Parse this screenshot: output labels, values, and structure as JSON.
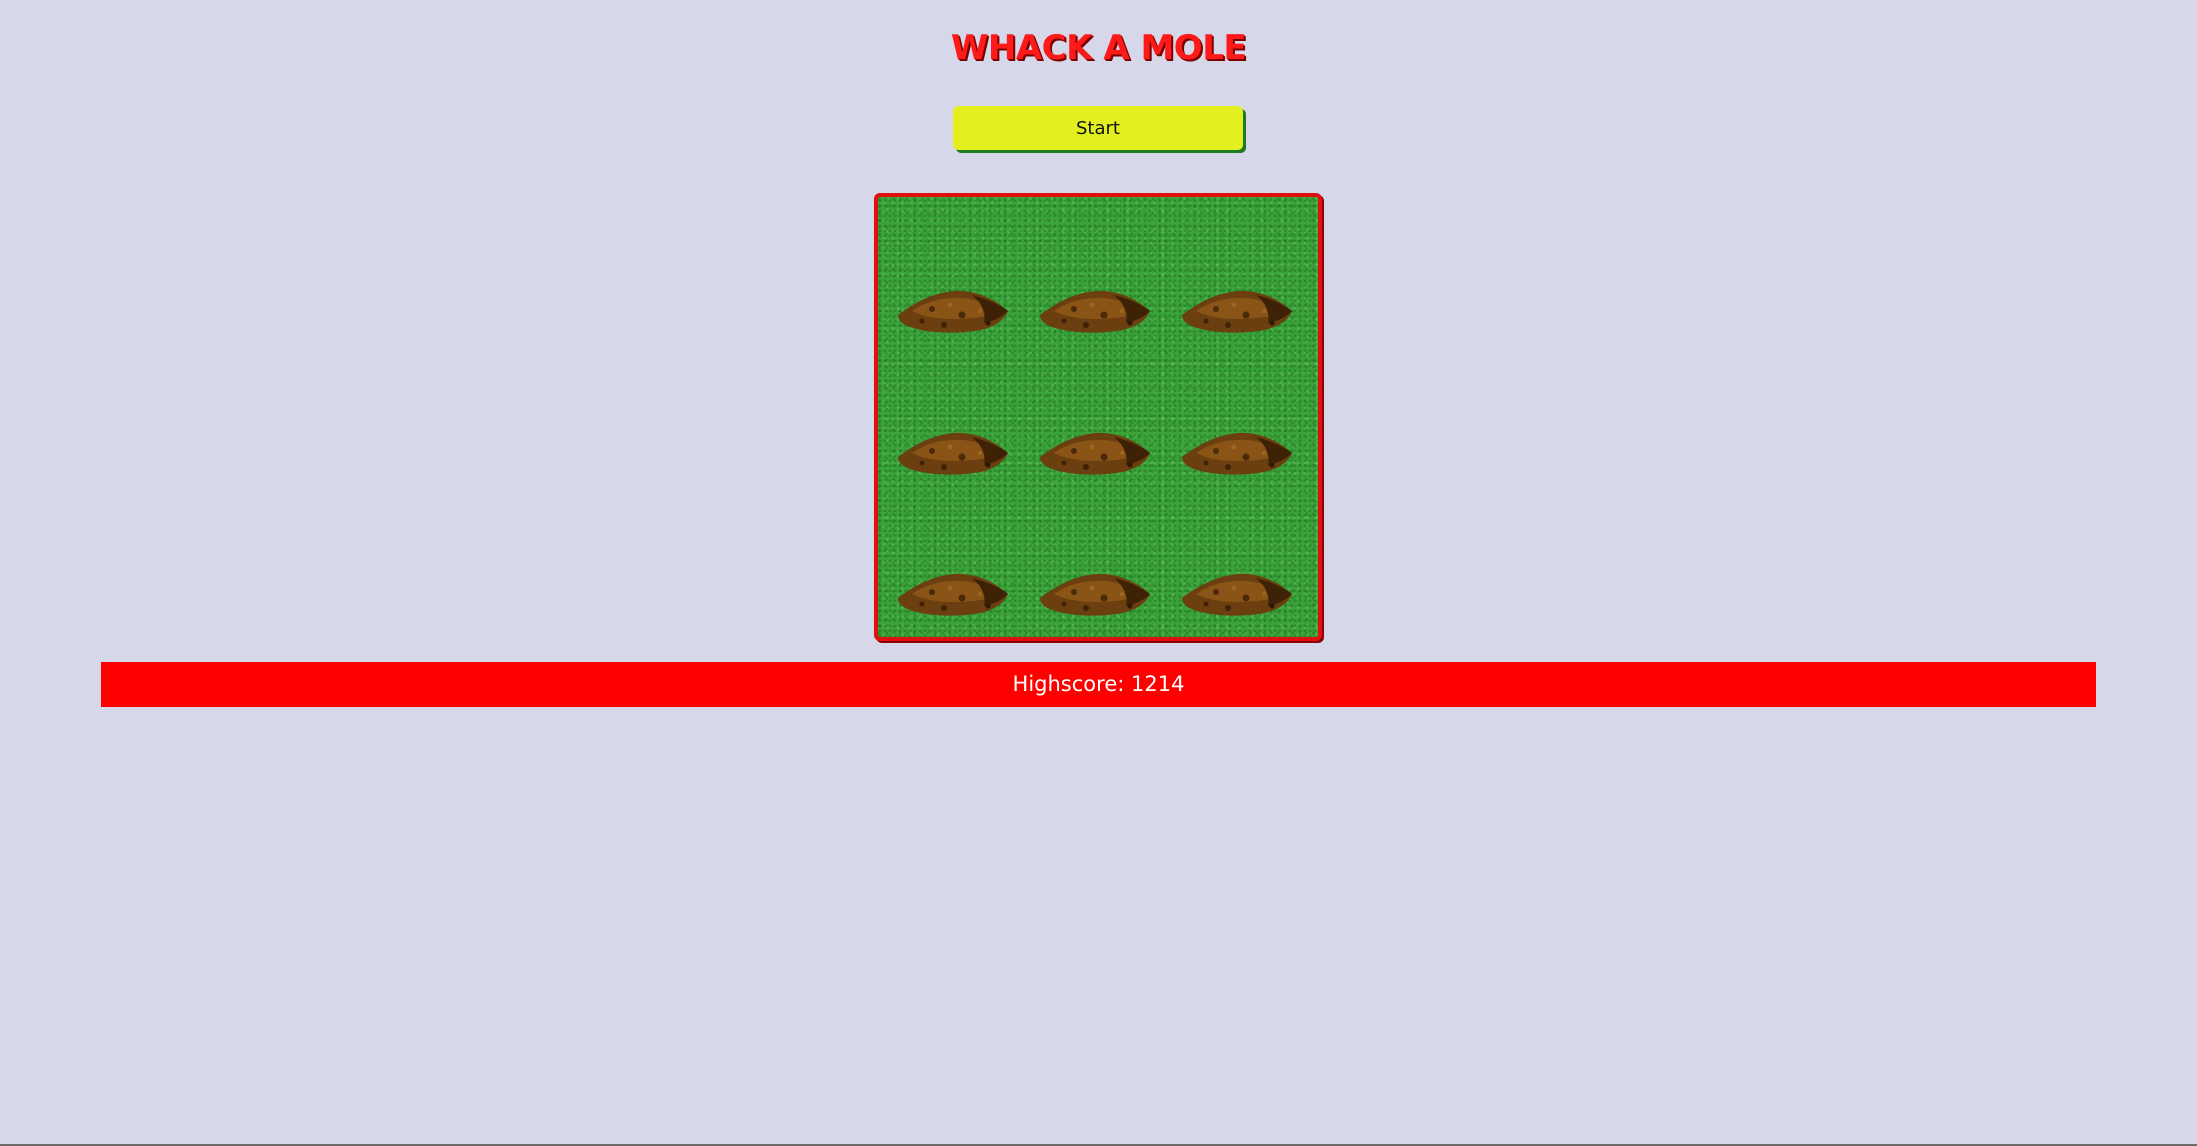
{
  "header": {
    "title": "WHACK A MOLE"
  },
  "controls": {
    "start_label": "Start"
  },
  "board": {
    "holes": [
      {
        "row": 1,
        "col": 1
      },
      {
        "row": 1,
        "col": 2
      },
      {
        "row": 1,
        "col": 3
      },
      {
        "row": 2,
        "col": 1
      },
      {
        "row": 2,
        "col": 2
      },
      {
        "row": 2,
        "col": 3
      },
      {
        "row": 3,
        "col": 1
      },
      {
        "row": 3,
        "col": 2
      },
      {
        "row": 3,
        "col": 3
      }
    ]
  },
  "scoreboard": {
    "highscore_text": "Highscore: 1214"
  },
  "colors": {
    "background": "#d6d7e8",
    "title": "#ff1a1a",
    "start_button": "#e3ef1f",
    "board_border": "#e01010",
    "grass": "#3aa33a",
    "dirt": "#6b3f0f",
    "highscore_bar": "#ff0000"
  }
}
